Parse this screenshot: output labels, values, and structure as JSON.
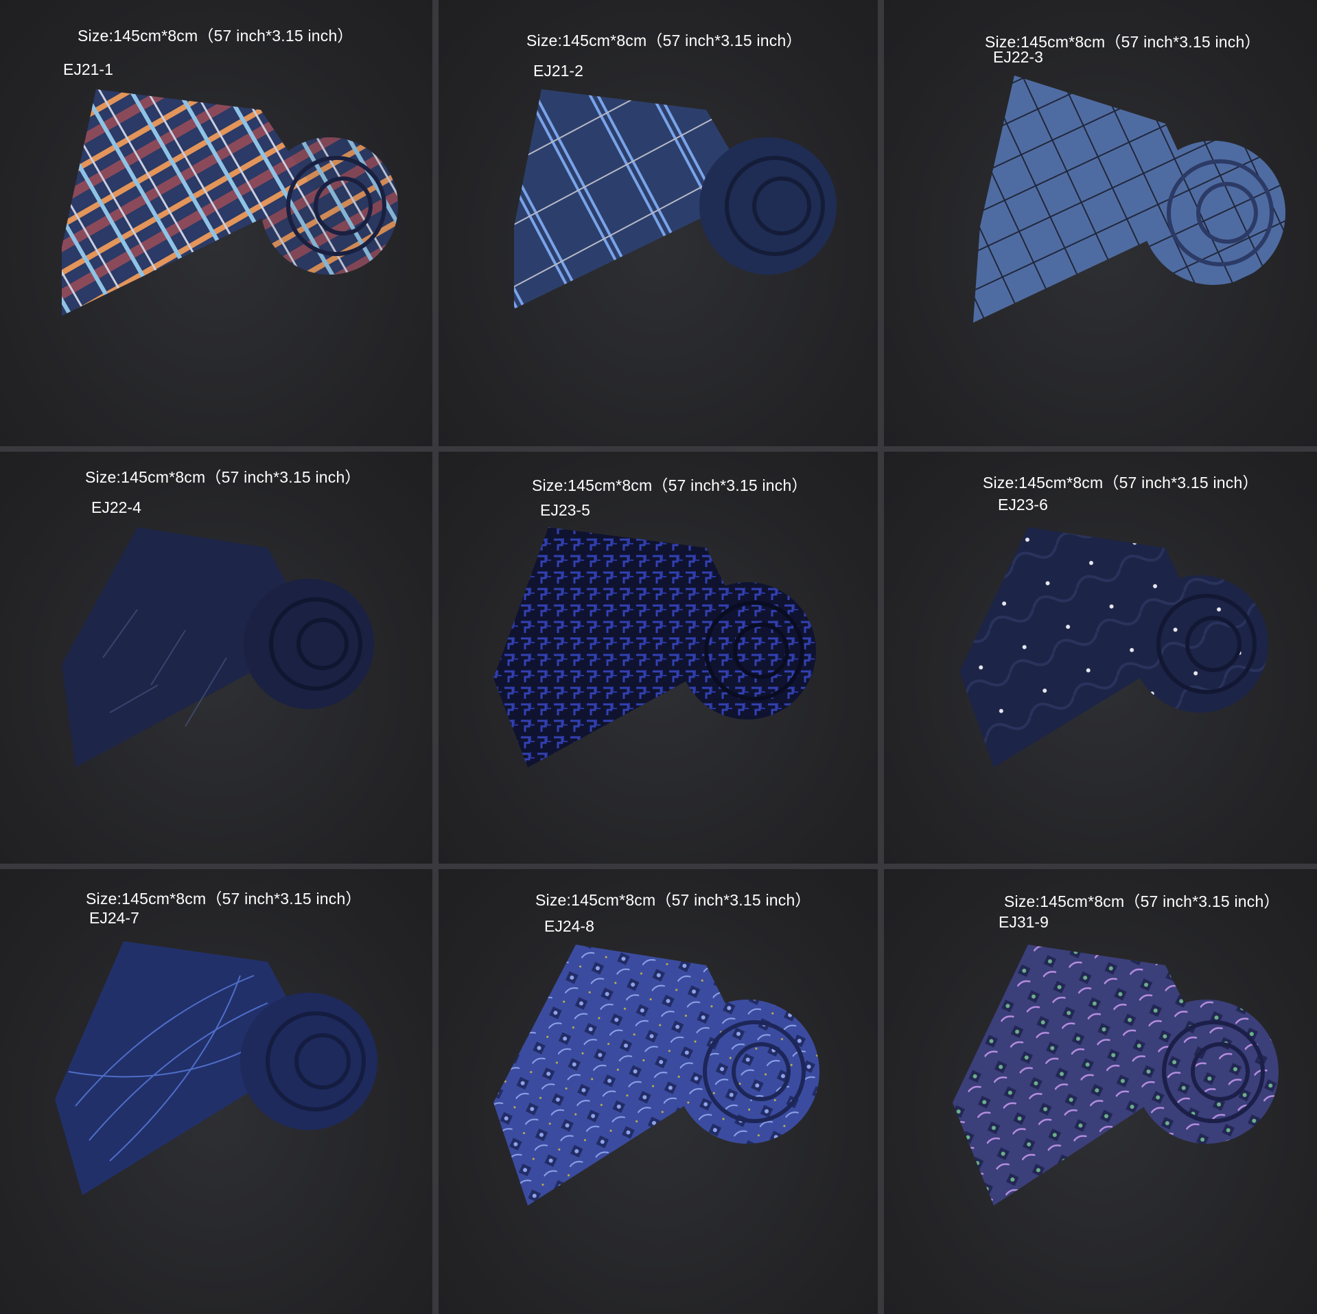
{
  "products": [
    {
      "code": "EJ21-1",
      "size": "Size:145cm*8cm（57 inch*3.15 inch）",
      "main": "#2b3a66",
      "accent1": "#e3955a",
      "accent2": "#8b4a5a",
      "accent3": "#8fc3e6",
      "pattern": "plaid"
    },
    {
      "code": "EJ21-2",
      "size": "Size:145cm*8cm（57 inch*3.15 inch）",
      "main": "#2c3f6c",
      "accent1": "#7aa3e8",
      "accent2": "#b9b9c8",
      "accent3": "#3a5a9a",
      "pattern": "stripe"
    },
    {
      "code": "EJ22-3",
      "size": "Size:145cm*8cm（57 inch*3.15 inch）",
      "main": "#4f6ca2",
      "accent1": "#20273c",
      "accent2": "#6e8cc4",
      "accent3": "#3c5180",
      "pattern": "check"
    },
    {
      "code": "EJ22-4",
      "size": "Size:145cm*8cm（57 inch*3.15 inch）",
      "main": "#1d2548",
      "accent1": "#4b5a8a",
      "accent2": "#2a3560",
      "accent3": "#141a34",
      "pattern": "scratch"
    },
    {
      "code": "EJ23-5",
      "size": "Size:145cm*8cm（57 inch*3.15 inch）",
      "main": "#1b2250",
      "accent1": "#3341b2",
      "accent2": "#0f1330",
      "accent3": "#2a36a0",
      "pattern": "maze"
    },
    {
      "code": "EJ23-6",
      "size": "Size:145cm*8cm（57 inch*3.15 inch）",
      "main": "#1c2447",
      "accent1": "#e6e8f0",
      "accent2": "#2a335c",
      "accent3": "#141a36",
      "pattern": "dots"
    },
    {
      "code": "EJ24-7",
      "size": "Size:145cm*8cm（57 inch*3.15 inch）",
      "main": "#22306a",
      "accent1": "#5a7ee0",
      "accent2": "#2d3f8a",
      "accent3": "#18214a",
      "pattern": "swirl"
    },
    {
      "code": "EJ24-8",
      "size": "Size:145cm*8cm（57 inch*3.15 inch）",
      "main": "#3b4ca0",
      "accent1": "#8fa4ea",
      "accent2": "#c4b14a",
      "accent3": "#222c66",
      "pattern": "paisley"
    },
    {
      "code": "EJ31-9",
      "size": "Size:145cm*8cm（57 inch*3.15 inch）",
      "main": "#3b3f7a",
      "accent1": "#b78ee0",
      "accent2": "#6cb08a",
      "accent3": "#232754",
      "pattern": "paisley"
    }
  ]
}
